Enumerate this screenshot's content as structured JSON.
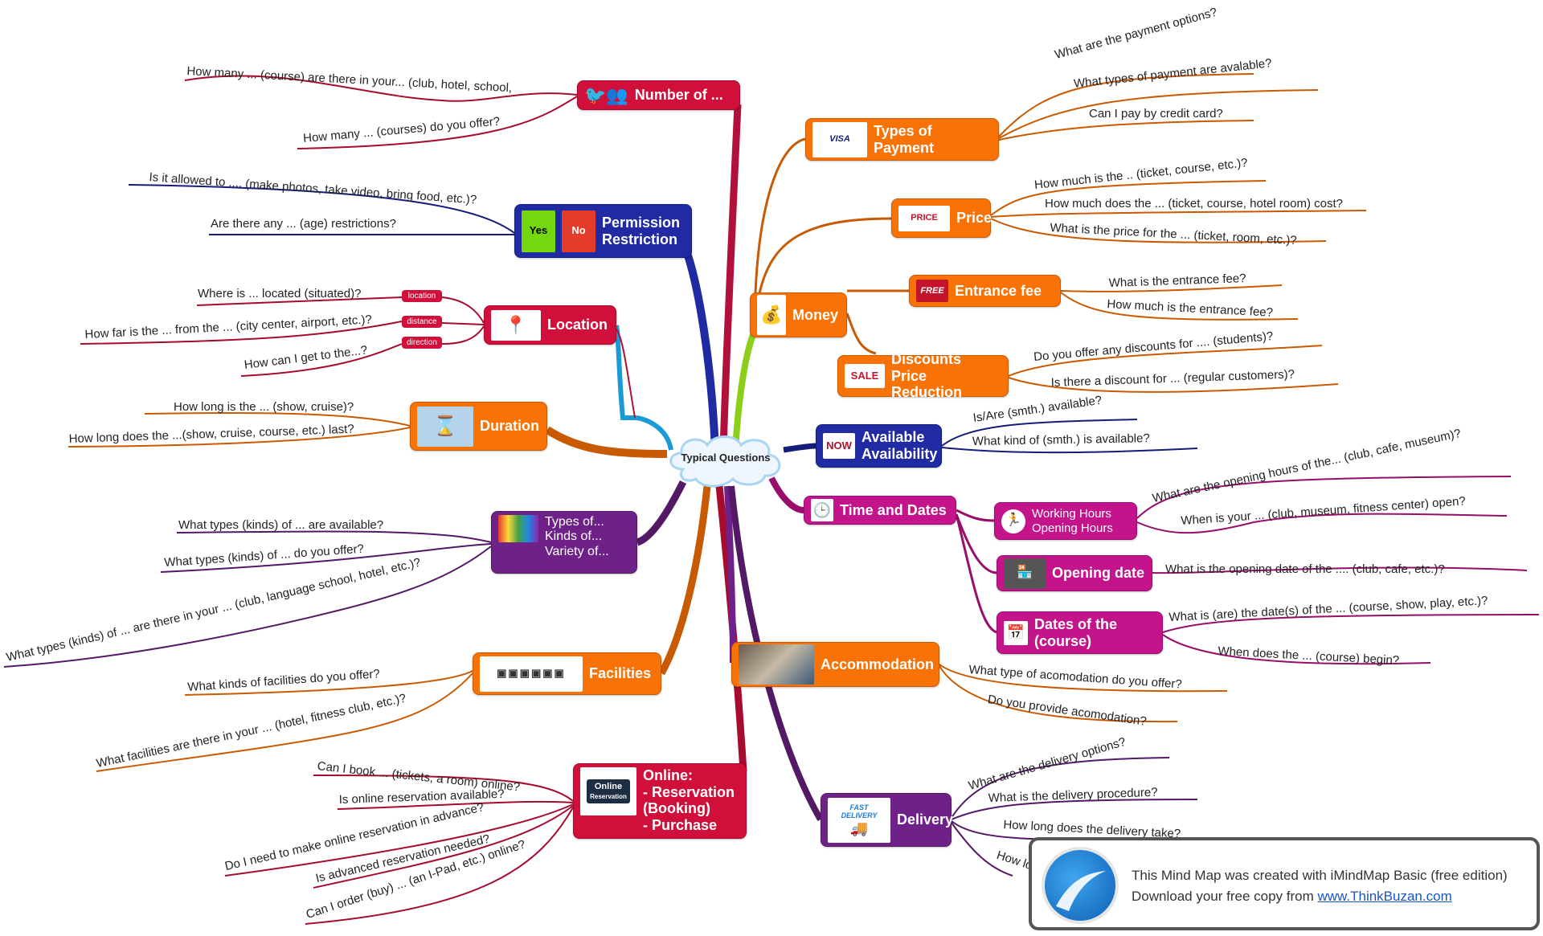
{
  "center": {
    "label": "Typical Questions"
  },
  "colors": {
    "red": "#d0103a",
    "navy": "#1f2aa3",
    "orange": "#f87206",
    "purple": "#6e2287",
    "magenta": "#c4148c",
    "lime": "#8ccf1a",
    "sky": "#1a9ad6"
  },
  "branches": {
    "number_of": {
      "label": "Number of ...",
      "icon": "bird-crowd-icon",
      "questions": [
        "How many ... (course) are there in your... (club, hotel, school,",
        "How many ... (courses) do you offer?"
      ]
    },
    "permission": {
      "label_line1": "Permission",
      "label_line2": "Restriction",
      "icon_yes": "Yes",
      "icon_no": "No",
      "questions": [
        "Is it allowed to .... (make photos, take video, bring food, etc.)?",
        "Are there any ... (age) restrictions?"
      ]
    },
    "location": {
      "label": "Location",
      "tags": [
        "location",
        "distance",
        "direction"
      ],
      "questions": [
        "Where is ... located (situated)?",
        "How far is the ... from the ... (city center, airport, etc.)?",
        "How can I get to the...?"
      ]
    },
    "duration": {
      "label": "Duration",
      "questions": [
        "How long is the ... (show, cruise)?",
        "How long does the ...(show, cruise, course, etc.) last?"
      ]
    },
    "types_of": {
      "label_line1": "Types of...",
      "label_line2": "Kinds of...",
      "label_line3": "Variety of...",
      "questions": [
        "What types (kinds) of ... are available?",
        "What types (kinds) of ... do you offer?",
        "What types (kinds) of ... are there in your ... (club, language school, hotel, etc.)?"
      ]
    },
    "facilities": {
      "label": "Facilities",
      "questions": [
        "What kinds of facilities do you offer?",
        "What facilities are there in your ... (hotel, fitness club, etc.)?"
      ]
    },
    "online": {
      "label_line1": "Online:",
      "label_line2": "- Reservation",
      "label_line3": "(Booking)",
      "label_line4": "- Purchase",
      "icon_text1": "Online",
      "icon_text2": "Reservation",
      "questions": [
        "Can I book ... (tickets, a room) online?",
        "Is online reservation available?",
        "Do I need to make online reservation in advance?",
        "Is advanced reservation needed?",
        "Can I order (buy) ... (an I-Pad, etc.) online?"
      ]
    },
    "money": {
      "label": "Money",
      "types_of_payment": {
        "label_line1": "Types of",
        "label_line2": "Payment",
        "icon_text": "VISA",
        "questions": [
          "What are the payment options?",
          "What types of payment are avalable?",
          "Can I pay by credit card?"
        ]
      },
      "price": {
        "label": "Price",
        "icon_text": "PRICE",
        "questions": [
          "How much is the .. (ticket, course, etc.)?",
          "How much does the ... (ticket, course, hotel room) cost?",
          "What is the price for the ... (ticket, room, etc.)?"
        ]
      },
      "entrance_fee": {
        "label": "Entrance fee",
        "icon_text": "FREE",
        "questions": [
          "What is the entrance fee?",
          "How much is the entrance fee?"
        ]
      },
      "discounts": {
        "label_line1": "Discounts",
        "label_line2": "Price Reduction",
        "icon_text": "SALE",
        "questions": [
          "Do you offer any discounts for .... (students)?",
          "Is there a discount for ... (regular customers)?"
        ]
      }
    },
    "available": {
      "label_line1": "Available",
      "label_line2": "Availability",
      "icon_text": "NOW",
      "questions": [
        "Is/Are (smth.) available?",
        "What kind of (smth.) is available?"
      ]
    },
    "time_dates": {
      "label": "Time and Dates",
      "working_hours": {
        "label_line1": "Working Hours",
        "label_line2": "Opening Hours",
        "questions": [
          "What are the opening hours of the... (club, cafe, museum)?",
          "When is your ... (club, museum, fitness center) open?"
        ]
      },
      "opening_date": {
        "label": "Opening date",
        "questions": [
          "What is the opening date of the .... (club, cafe, etc.)?"
        ]
      },
      "dates_of": {
        "label_line1": "Dates of the",
        "label_line2": "(course)",
        "questions": [
          "What is (are) the date(s) of the ... (course, show, play, etc.)?",
          "When does the ... (course) begin?"
        ]
      }
    },
    "accommodation": {
      "label": "Accommodation",
      "questions": [
        "What type of acomodation do you offer?",
        "Do you provide acomodation?"
      ]
    },
    "delivery": {
      "label": "Delivery",
      "icon_text1": "FAST",
      "icon_text2": "DELIVERY",
      "questions": [
        "What are the delivery options?",
        "What is the delivery procedure?",
        "How long does the delivery take?",
        "How lo... delivery?"
      ]
    }
  },
  "watermark": {
    "line1": "This Mind Map was created with iMindMap Basic (free edition)",
    "line2_prefix": "Download your free copy from ",
    "link": "www.ThinkBuzan.com"
  }
}
